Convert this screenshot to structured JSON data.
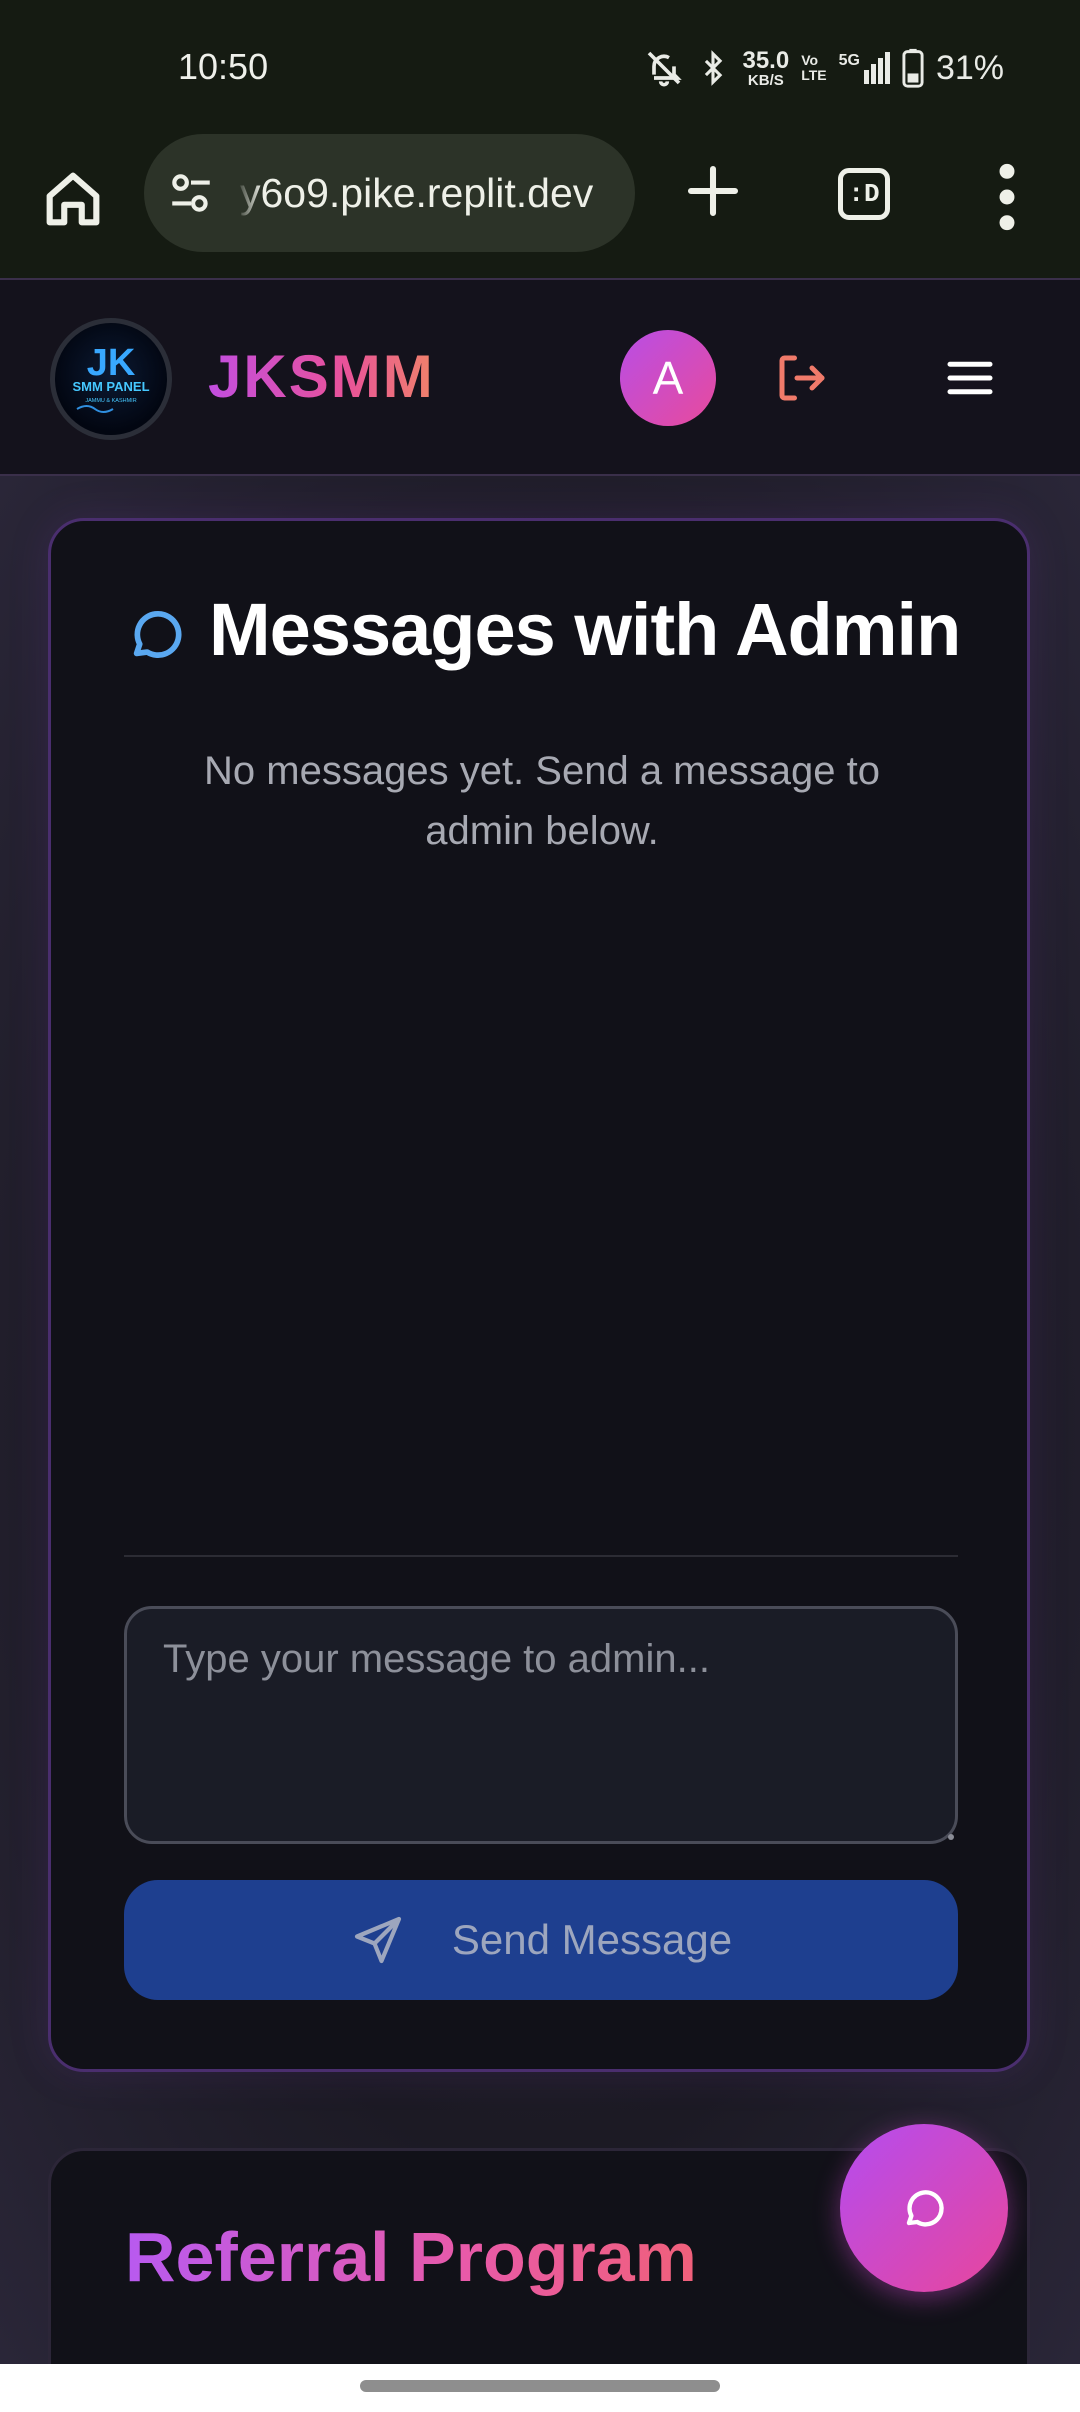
{
  "status_bar": {
    "time": "10:50",
    "net_speed_value": "35.0",
    "net_speed_unit": "KB/S",
    "volte_top": "Vo",
    "volte_bottom": "LTE",
    "network": "5G",
    "battery": "31%",
    "icons": [
      "bell-off-icon",
      "bluetooth-icon",
      "signal-icon",
      "battery-icon"
    ]
  },
  "browser": {
    "url": "y6o9.pike.replit.dev",
    "tabs_label": ":D",
    "icons": [
      "home-icon",
      "site-settings-icon",
      "plus-icon",
      "more-vert-icon"
    ]
  },
  "header": {
    "logo_top": "JK",
    "logo_mid": "SMM PANEL",
    "logo_sub": "JAMMU & KASHMIR",
    "brand": "JKSMM",
    "avatar_letter": "A",
    "icons": [
      "logout-icon",
      "menu-icon"
    ],
    "colors": {
      "logout": "#f07a6a",
      "avatar_from": "#b84ee6",
      "avatar_to": "#e84a9c"
    }
  },
  "messages": {
    "title": "Messages with Admin",
    "empty_text": "No messages yet. Send a message to admin below.",
    "input_placeholder": "Type your message to admin...",
    "send_label": "Send Message",
    "colors": {
      "title_icon": "#5aa8f0",
      "send_button": "#1e3f8f",
      "card_border": "#4a2e6e"
    }
  },
  "referral": {
    "title": "Referral Program"
  },
  "fab": {
    "icon": "chat-bubble-icon"
  }
}
